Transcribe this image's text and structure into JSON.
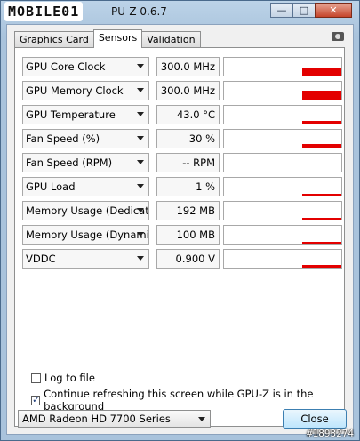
{
  "window": {
    "logo": "MOBILE01",
    "title": "PU-Z 0.6.7",
    "minimize": "—",
    "maximize": "□",
    "close": "✕"
  },
  "tabs": [
    {
      "label": "Graphics Card",
      "active": false
    },
    {
      "label": "Sensors",
      "active": true
    },
    {
      "label": "Validation",
      "active": false
    }
  ],
  "sensors": [
    {
      "label": "GPU Core Clock",
      "value": "300.0 MHz",
      "level": 0.45
    },
    {
      "label": "GPU Memory Clock",
      "value": "300.0 MHz",
      "level": 0.5
    },
    {
      "label": "GPU Temperature",
      "value": "43.0 °C",
      "level": 0.15
    },
    {
      "label": "Fan Speed (%)",
      "value": "30 %",
      "level": 0.2
    },
    {
      "label": "Fan Speed (RPM)",
      "value": "-- RPM",
      "level": 0
    },
    {
      "label": "GPU Load",
      "value": "1 %",
      "level": 0.05
    },
    {
      "label": "Memory Usage (Dedicated)",
      "value": "192 MB",
      "level": 0.1
    },
    {
      "label": "Memory Usage (Dynamic)",
      "value": "100 MB",
      "level": 0.08
    },
    {
      "label": "VDDC",
      "value": "0.900 V",
      "level": 0.15
    }
  ],
  "options": {
    "log_to_file": {
      "label": "Log to file",
      "checked": false
    },
    "continue_refresh": {
      "label": "Continue refreshing this screen while GPU-Z is in the background",
      "checked": true
    }
  },
  "footer": {
    "gpu_selected": "AMD Radeon HD 7700 Series",
    "close_label": "Close"
  },
  "watermark": "#1893274",
  "colors": {
    "graph_bar": "#e30000",
    "title_bar": "#a9c3dc"
  }
}
